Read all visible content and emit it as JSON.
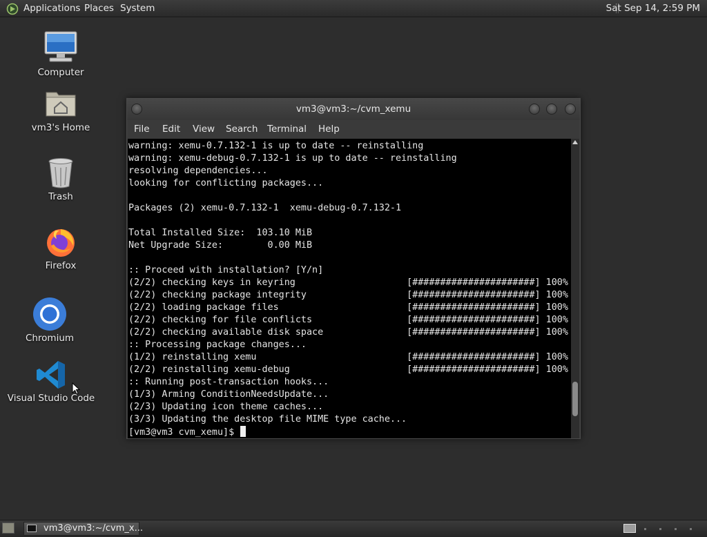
{
  "top_panel": {
    "menus": [
      "Applications",
      "Places",
      "System"
    ],
    "clock": "Sat Sep 14,  2:59 PM"
  },
  "desktop_icons": [
    {
      "label": "Computer",
      "icon": "computer-icon"
    },
    {
      "label": "vm3's Home",
      "icon": "home-folder-icon"
    },
    {
      "label": "Trash",
      "icon": "trash-icon"
    },
    {
      "label": "Firefox",
      "icon": "firefox-icon"
    },
    {
      "label": "Chromium",
      "icon": "chromium-icon"
    },
    {
      "label": "Visual Studio Code",
      "icon": "vscode-icon"
    }
  ],
  "terminal": {
    "title": "vm3@vm3:~/cvm_xemu",
    "menu": [
      "File",
      "Edit",
      "View",
      "Search",
      "Terminal",
      "Help"
    ],
    "lines": [
      "warning: xemu-0.7.132-1 is up to date -- reinstalling",
      "warning: xemu-debug-0.7.132-1 is up to date -- reinstalling",
      "resolving dependencies...",
      "looking for conflicting packages...",
      "",
      "Packages (2) xemu-0.7.132-1  xemu-debug-0.7.132-1",
      "",
      "Total Installed Size:  103.10 MiB",
      "Net Upgrade Size:        0.00 MiB",
      "",
      ":: Proceed with installation? [Y/n]",
      "(2/2) checking keys in keyring                    [######################] 100%",
      "(2/2) checking package integrity                  [######################] 100%",
      "(2/2) loading package files                       [######################] 100%",
      "(2/2) checking for file conflicts                 [######################] 100%",
      "(2/2) checking available disk space               [######################] 100%",
      ":: Processing package changes...",
      "(1/2) reinstalling xemu                           [######################] 100%",
      "(2/2) reinstalling xemu-debug                     [######################] 100%",
      ":: Running post-transaction hooks...",
      "(1/3) Arming ConditionNeedsUpdate...",
      "(2/3) Updating icon theme caches...",
      "(3/3) Updating the desktop file MIME type cache..."
    ],
    "prompt": "[vm3@vm3 cvm_xemu]$ ",
    "scroll_position": 0.92
  },
  "taskbar": {
    "window_label": "vm3@vm3:~/cvm_x..."
  },
  "colors": {
    "desktop_bg": "#2d2d2d",
    "terminal_bg": "#000000",
    "chromium_blue": "#3b7dd8",
    "vscode_blue": "#1f8ad2"
  }
}
